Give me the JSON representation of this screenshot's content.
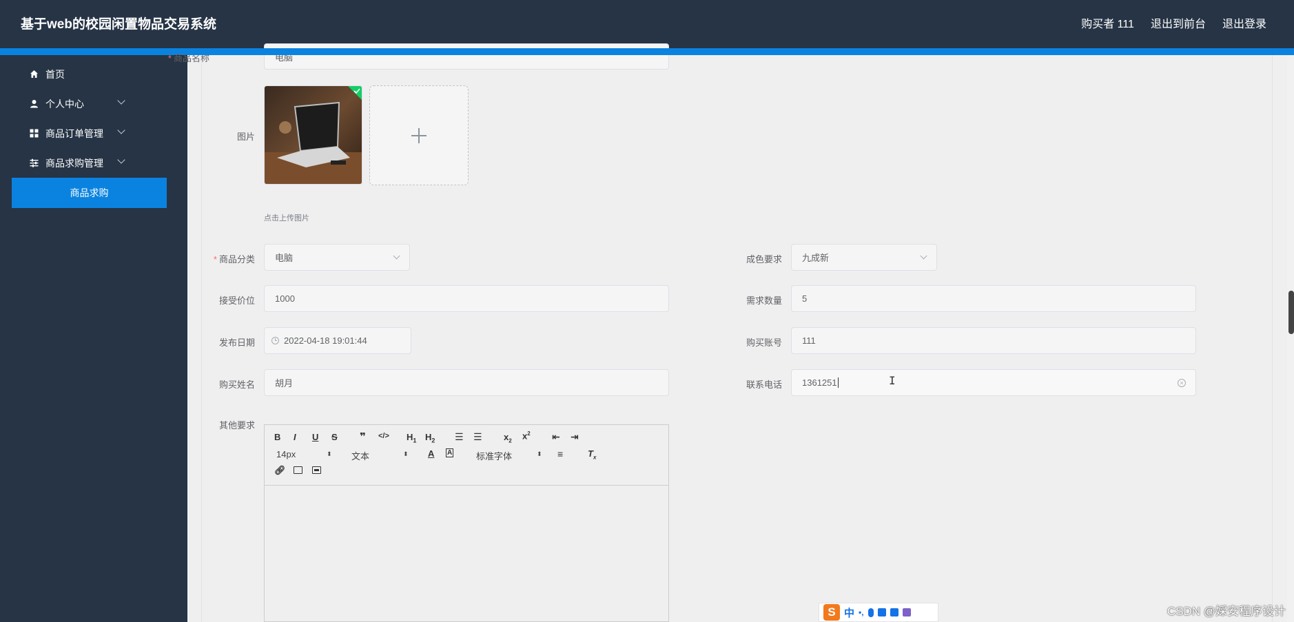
{
  "header": {
    "app_title": "基于web的校园闲置物品交易系统",
    "user_label": "购买者 111",
    "front_link": "退出到前台",
    "logout_link": "退出登录"
  },
  "sidebar": {
    "items": [
      {
        "label": "首页",
        "icon": "home-icon"
      },
      {
        "label": "个人中心",
        "icon": "user-icon"
      },
      {
        "label": "商品订单管理",
        "icon": "grid-icon"
      },
      {
        "label": "商品求购管理",
        "icon": "sliders-icon"
      }
    ],
    "active_sub": "商品求购"
  },
  "form": {
    "name_label": "商品名称",
    "name_value": "电脑",
    "image_label": "图片",
    "upload_tip": "点击上传图片",
    "category_label": "商品分类",
    "category_value": "电脑",
    "condition_label": "成色要求",
    "condition_value": "九成新",
    "price_label": "接受价位",
    "price_value": "1000",
    "qty_label": "需求数量",
    "qty_value": "5",
    "date_label": "发布日期",
    "date_value": "2022-04-18 19:01:44",
    "account_label": "购买账号",
    "account_value": "111",
    "buyer_name_label": "购买姓名",
    "buyer_name_value": "胡月",
    "phone_label": "联系电话",
    "phone_value": "1361251",
    "other_label": "其他要求"
  },
  "editor": {
    "font_size": "14px",
    "block_type": "文本",
    "font_family": "标准字体"
  },
  "ime": {
    "lang": "中"
  },
  "watermark": "CSDN @婇安程序设计",
  "colors": {
    "header_bg": "#263445",
    "accent": "#0a83e0",
    "page_bg": "#f0eff0"
  }
}
